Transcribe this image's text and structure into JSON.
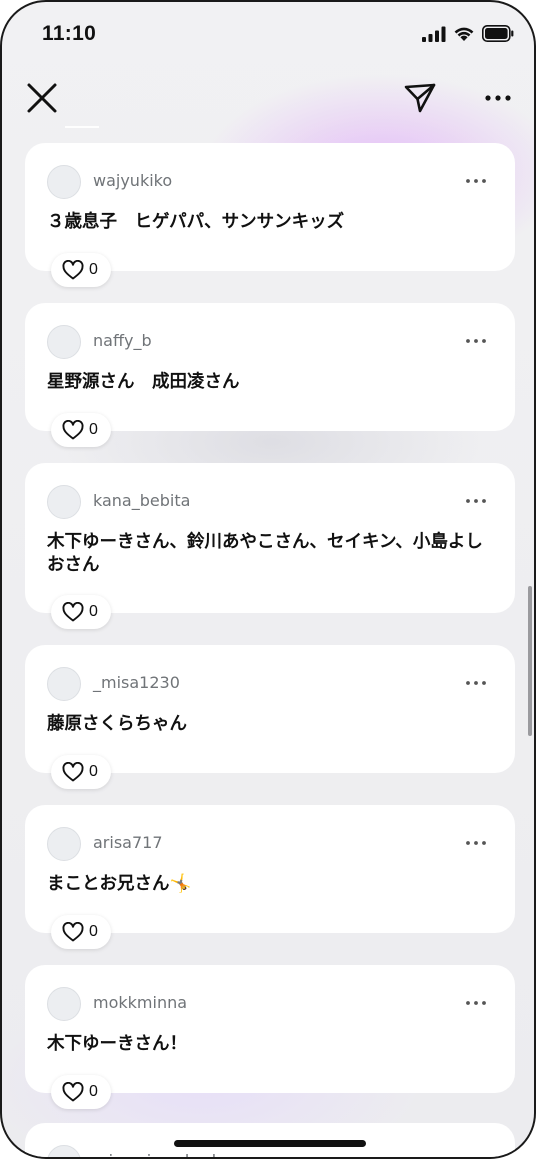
{
  "status_bar": {
    "time": "11:10"
  },
  "top_bar": {
    "close_icon": "close-icon",
    "send_icon": "paper-plane-icon",
    "more_icon": "more-horizontal-icon"
  },
  "comments": [
    {
      "username": "wajyukiko",
      "text": "３歳息子　ヒゲパパ、サンサンキッズ",
      "likes": "0"
    },
    {
      "username": "naffy_b",
      "text": "星野源さん　成田凌さん",
      "likes": "0"
    },
    {
      "username": "kana_bebita",
      "text": "木下ゆーきさん、鈴川あやこさん、セイキン、小島よしおさん",
      "likes": "0"
    },
    {
      "username": "_misa1230",
      "text": "藤原さくらちゃん",
      "likes": "0"
    },
    {
      "username": "arisa717",
      "text": "まことお兄さん🤸",
      "likes": "0"
    },
    {
      "username": "mokkminna",
      "text": "木下ゆーきさん！",
      "likes": "0"
    }
  ],
  "partial_comment": {
    "username": "misomi_mukoshop"
  },
  "colors": {
    "background": "#efeff1",
    "accent_glow": "#e2b4f8",
    "card": "#ffffff",
    "username": "#707478"
  }
}
